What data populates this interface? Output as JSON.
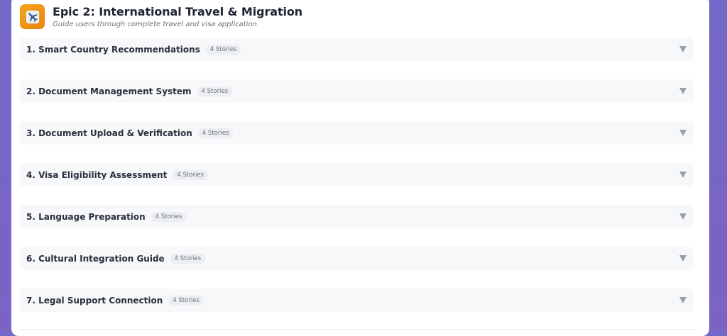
{
  "epic": {
    "title": "Epic 2: International Travel & Migration",
    "subtitle": "Guide users through complete travel and visa application",
    "icon": "airplane-icon",
    "icon_color": "#f39c12"
  },
  "features": [
    {
      "title": "1. Smart Country Recommendations",
      "badge": "4 Stories"
    },
    {
      "title": "2. Document Management System",
      "badge": "4 Stories"
    },
    {
      "title": "3. Document Upload & Verification",
      "badge": "4 Stories"
    },
    {
      "title": "4. Visa Eligibility Assessment",
      "badge": "4 Stories"
    },
    {
      "title": "5. Language Preparation",
      "badge": "4 Stories"
    },
    {
      "title": "6. Cultural Integration Guide",
      "badge": "4 Stories"
    },
    {
      "title": "7. Legal Support Connection",
      "badge": "4 Stories"
    }
  ],
  "colors": {
    "background": "#7468c8",
    "card": "#ffffff",
    "row": "#f7f8fa"
  }
}
